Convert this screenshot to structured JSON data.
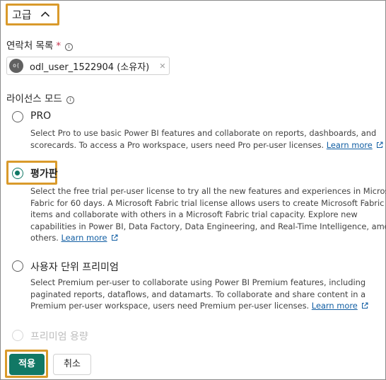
{
  "advanced": {
    "title": "고급",
    "toggle_icon": "chevron-up-icon"
  },
  "contacts": {
    "label": "연락처 목록",
    "required": "*",
    "info_icon": "info-icon",
    "chip": {
      "avatar": "o(",
      "text": "odl_user_1522904 (소유자)",
      "remove": "✕"
    }
  },
  "license": {
    "label": "라이선스 모드",
    "info_icon": "info-icon",
    "options": [
      {
        "title": "PRO",
        "checked": false,
        "lines": [
          "Select Pro to use basic Power BI features and collaborate on reports, dashboards, and",
          "scorecards. To access a Pro workspace, users need Pro per-user licenses."
        ],
        "link": "Learn more"
      },
      {
        "title": "평가판",
        "checked": true,
        "lines": [
          "Select the free trial per-user license to try all the new features and experiences in Microsoft",
          "Fabric for 60 days. A Microsoft Fabric trial license allows users to create Microsoft Fabric",
          "items and collaborate with others in a Microsoft Fabric trial capacity. Explore new",
          "capabilities in Power BI, Data Factory, Data Engineering, and Real-Time Intelligence, among",
          "others."
        ],
        "link": "Learn more"
      },
      {
        "title": "사용자 단위 프리미엄",
        "checked": false,
        "lines": [
          "Select Premium per-user to collaborate using Power BI Premium features, including",
          "paginated reports, dataflows, and datamarts. To collaborate and share content in a",
          "Premium per-user workspace, users need Premium per-user licenses."
        ],
        "link": "Learn more"
      },
      {
        "title": "프리미엄 용량",
        "checked": false,
        "disabled": true
      }
    ]
  },
  "actions": {
    "apply": "적용",
    "cancel": "취소"
  },
  "colors": {
    "accent": "#117865",
    "highlight": "#d99a2b",
    "link": "#115ea3"
  }
}
